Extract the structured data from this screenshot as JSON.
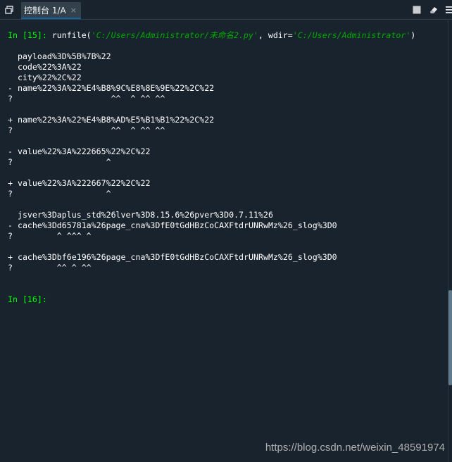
{
  "tabbar": {
    "tab_label": "控制台 1/A",
    "close_glyph": "×",
    "menu_icon": "tab-menu-icon",
    "stop_icon": "stop-icon",
    "clear_icon": "eraser-icon",
    "options_icon": "options-icon"
  },
  "console": {
    "prompt1": "In [15]:",
    "cmd_fn": " runfile(",
    "cmd_file": "'C:/Users/Administrator/未命名2.py'",
    "cmd_mid": ", wdir=",
    "cmd_wdir": "'C:/Users/Administrator'",
    "cmd_end": ")",
    "output": [
      "",
      "  payload%3D%5B%7B%22",
      "  code%22%3A%22",
      "  city%22%2C%22",
      "- name%22%3A%22%E4%B8%9C%E8%8E%9E%22%2C%22",
      "?                    ^^  ^ ^^ ^^",
      "",
      "+ name%22%3A%22%E4%B8%AD%E5%B1%B1%22%2C%22",
      "?                    ^^  ^ ^^ ^^",
      "",
      "- value%22%3A%222665%22%2C%22",
      "?                   ^",
      "",
      "+ value%22%3A%222667%22%2C%22",
      "?                   ^",
      "",
      "  jsver%3Daplus_std%26lver%3D8.15.6%26pver%3D0.7.11%26",
      "- cache%3Dd65781a%26page_cna%3DfE0tGdHBzCoCAXFtdrUNRwMz%26_slog%3D0",
      "?         ^ ^^^ ^",
      "",
      "+ cache%3Dbf6e196%26page_cna%3DfE0tGdHBzCoCAXFtdrUNRwMz%26_slog%3D0",
      "?         ^^ ^ ^^",
      "",
      ""
    ],
    "prompt2": "In [16]:"
  },
  "watermark": "https://blog.csdn.net/weixin_48591974",
  "colors": {
    "background": "#19232d",
    "prompt": "#00ff00",
    "tab_accent": "#1464a0"
  }
}
